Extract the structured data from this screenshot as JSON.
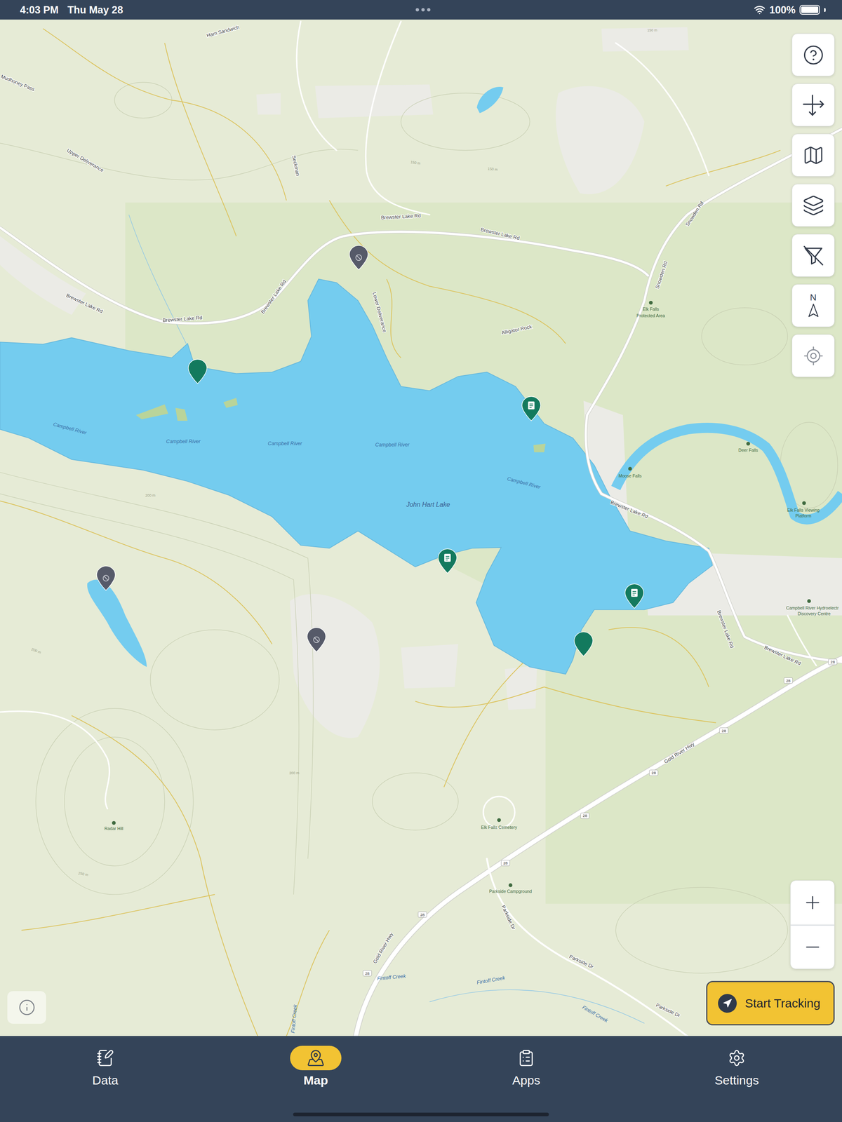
{
  "status_bar": {
    "time": "4:03 PM",
    "date": "Thu May 28",
    "battery": "100%",
    "battery_level": 1.0
  },
  "map": {
    "labels": [
      "Ham Sandwich",
      "Mudhoney Pass",
      "Upper Deliverance",
      "Seckman",
      "Brewster Lake Rd",
      "Brewster Lake Rd",
      "Brewster Lake Rd",
      "Brewster Lake Rd",
      "Brewster Lake Rd",
      "Lower Deliverance",
      "Alligator Rock",
      "Elk Falls",
      "Protected Area",
      "Snowden Rd",
      "Snowden Rd",
      "Campbell River",
      "Campbell River",
      "Campbell River",
      "Campbell River",
      "Campbell River",
      "John Hart Lake",
      "Moose Falls",
      "Deer Falls",
      "Elk Falls Viewing",
      "Platform",
      "Brewster Lake Rd",
      "Brewster Lake Rd",
      "Brewster Lake Rd",
      "Campbell River Hydroelectr",
      "Discovery Centre",
      "Gold River Hwy",
      "Gold River Hwy",
      "Radar Hill",
      "Elk Falls Cemetery",
      "Parkside Campground",
      "Parkside Dr",
      "Parkside Dr",
      "Parkside Dr",
      "Fintoff Creek",
      "Fintoff Creek",
      "Fintoff Creek",
      "Fintoff Creek",
      "150 m",
      "150 m",
      "150 m",
      "200 m",
      "200 m",
      "250 m",
      "200 m"
    ],
    "shields": [
      "28",
      "28",
      "28",
      "28",
      "28",
      "28",
      "28",
      "28"
    ],
    "pins": [
      {
        "kind": "plain"
      },
      {
        "kind": "form"
      },
      {
        "kind": "form"
      },
      {
        "kind": "form"
      },
      {
        "kind": "plain"
      },
      {
        "kind": "inactive"
      },
      {
        "kind": "inactive"
      },
      {
        "kind": "inactive"
      }
    ]
  },
  "toolbar": {
    "compass_label": "N"
  },
  "tracking_button": {
    "label": "Start Tracking"
  },
  "nav": [
    {
      "label": "Data",
      "selected": false
    },
    {
      "label": "Map",
      "selected": true
    },
    {
      "label": "Apps",
      "selected": false
    },
    {
      "label": "Settings",
      "selected": false
    }
  ]
}
